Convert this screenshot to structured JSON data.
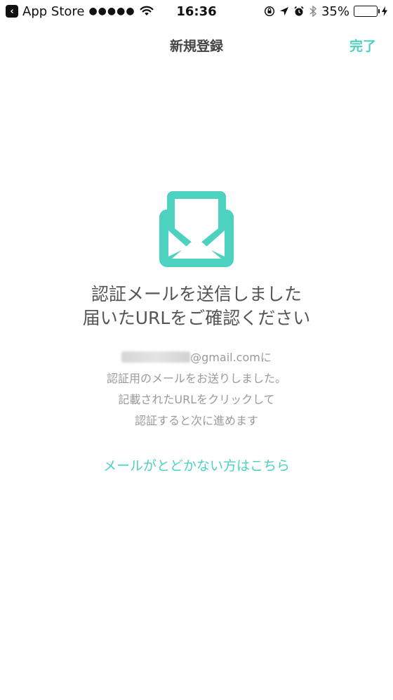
{
  "status_bar": {
    "back_app": "App Store",
    "signal": "●●●●●",
    "time": "16:36",
    "battery_percent": "35%",
    "battery_level": 0.35
  },
  "nav": {
    "title": "新規登録",
    "done": "完了"
  },
  "main": {
    "headline_line1": "認証メールを送信しました",
    "headline_line2": "届いたURLをご確認ください",
    "email_suffix": "@gmail.comに",
    "desc_line1": "認証用のメールをお送りしました。",
    "desc_line2": "記載されたURLをクリックして",
    "desc_line3": "認証すると次に進めます",
    "no_mail_link": "メールがとどかない方はこちら"
  },
  "colors": {
    "accent": "#4dd2c0",
    "text": "#555555",
    "muted": "#9a9a9a"
  }
}
